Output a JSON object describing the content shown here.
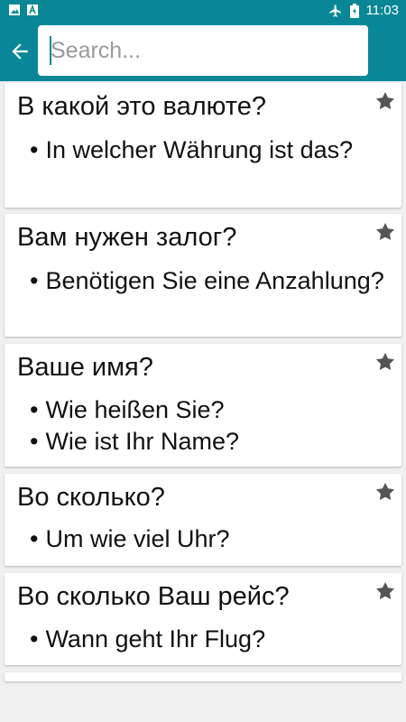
{
  "status_bar": {
    "time": "11:03",
    "icons": [
      "image-icon",
      "a-icon",
      "airplane-icon",
      "battery-icon"
    ]
  },
  "toolbar": {
    "back_icon": "arrow-left-icon",
    "search_placeholder": "Search...",
    "search_value": ""
  },
  "phrases": [
    {
      "title": "В какой это валюте?",
      "translations": [
        "In welcher Währung ist das?"
      ],
      "starred": true
    },
    {
      "title": "Вам нужен залог?",
      "translations": [
        "Benötigen Sie eine Anzahlung?"
      ],
      "starred": true
    },
    {
      "title": "Ваше имя?",
      "translations": [
        "Wie heißen Sie?",
        "Wie ist Ihr Name?"
      ],
      "starred": true
    },
    {
      "title": "Во сколько?",
      "translations": [
        "Um wie viel Uhr?"
      ],
      "starred": true
    },
    {
      "title": "Во сколько Ваш рейс?",
      "translations": [
        "Wann geht Ihr Flug?"
      ],
      "starred": true
    }
  ],
  "colors": {
    "accent": "#0a8796",
    "star": "#555555",
    "background": "#f0f0f0"
  }
}
